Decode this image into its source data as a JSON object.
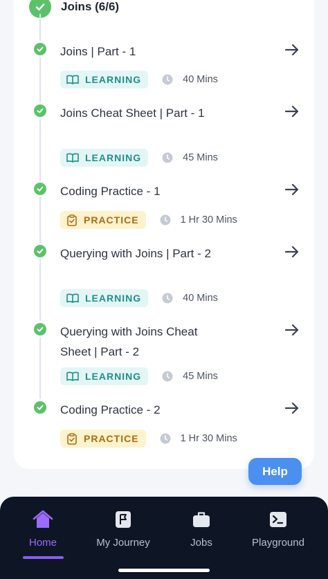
{
  "section": {
    "title": "Joins (6/6)"
  },
  "items": [
    {
      "title": "Joins | Part - 1",
      "type": "LEARNING",
      "duration": "40 Mins"
    },
    {
      "title": "Joins Cheat Sheet | Part - 1",
      "type": "LEARNING",
      "duration": "45 Mins"
    },
    {
      "title": "Coding Practice - 1",
      "type": "PRACTICE",
      "duration": "1 Hr 30 Mins"
    },
    {
      "title": "Querying with Joins | Part - 2",
      "type": "LEARNING",
      "duration": "40 Mins"
    },
    {
      "title": "Querying with Joins Cheat Sheet | Part - 2",
      "type": "LEARNING",
      "duration": "45 Mins"
    },
    {
      "title": "Coding Practice - 2",
      "type": "PRACTICE",
      "duration": "1 Hr 30 Mins"
    }
  ],
  "help": {
    "label": "Help"
  },
  "nav": {
    "items": [
      {
        "label": "Home",
        "icon": "home-icon",
        "active": true
      },
      {
        "label": "My Journey",
        "icon": "flag-icon",
        "active": false
      },
      {
        "label": "Jobs",
        "icon": "briefcase-icon",
        "active": false
      },
      {
        "label": "Playground",
        "icon": "terminal-icon",
        "active": false
      }
    ]
  },
  "colors": {
    "complete": "#5cc26a",
    "learning_bg": "#e3f6f5",
    "learning_text": "#1f8f8a",
    "practice_bg": "#fdf3cd",
    "practice_text": "#b06a12",
    "help_button": "#4b8ff0",
    "nav_bg": "#0e1525",
    "nav_active": "#9b6bff"
  }
}
